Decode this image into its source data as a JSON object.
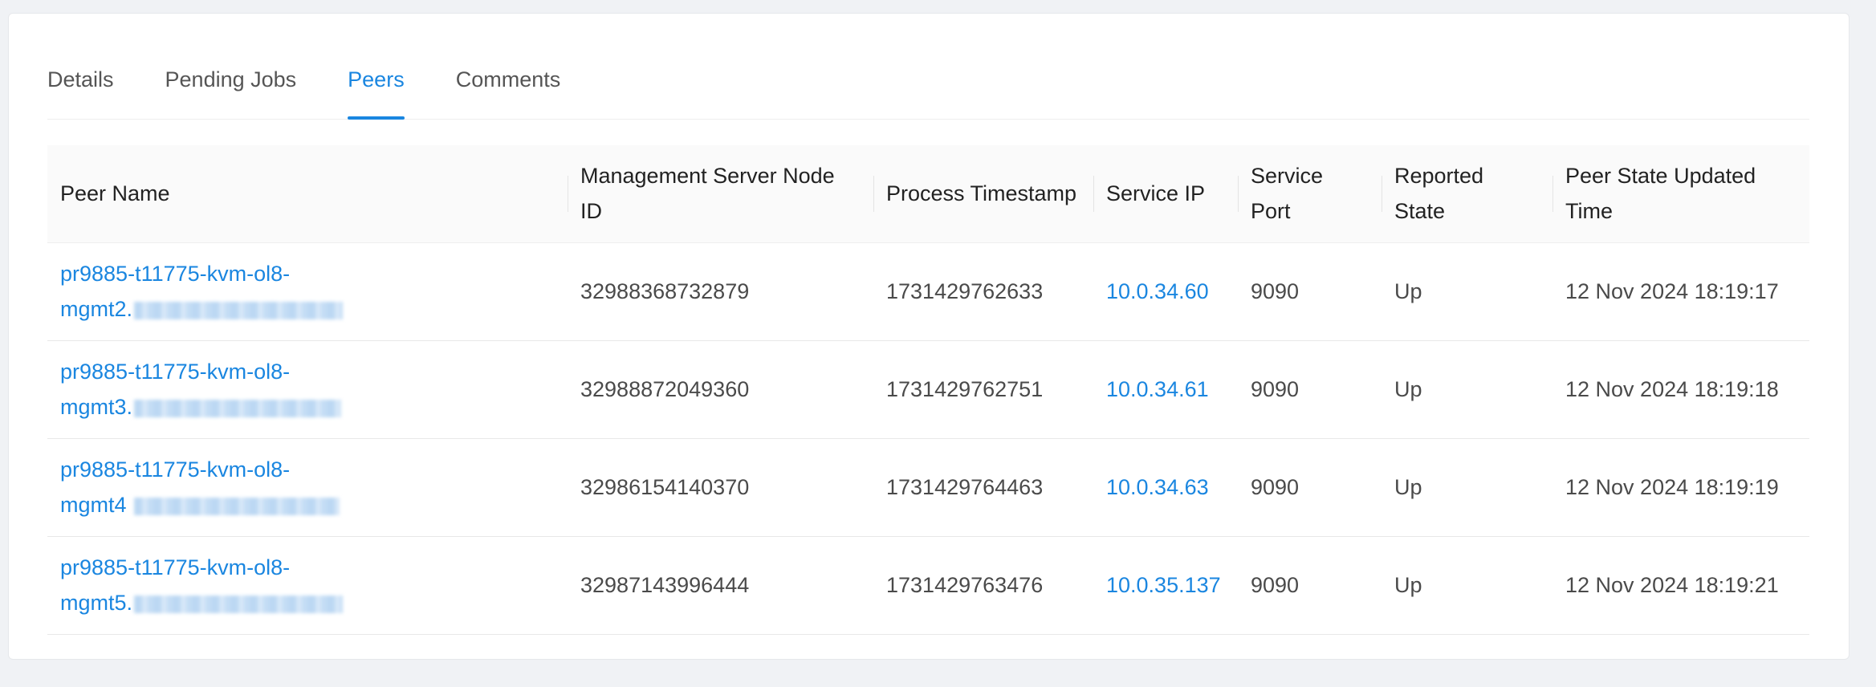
{
  "tabs": [
    {
      "label": "Details",
      "active": false
    },
    {
      "label": "Pending Jobs",
      "active": false
    },
    {
      "label": "Peers",
      "active": true
    },
    {
      "label": "Comments",
      "active": false
    }
  ],
  "table": {
    "columns": [
      "Peer Name",
      "Management Server Node ID",
      "Process Timestamp",
      "Service IP",
      "Service Port",
      "Reported State",
      "Peer State Updated Time"
    ],
    "rows": [
      {
        "peer_name_line1": "pr9885-t11775-kvm-ol8-",
        "peer_name_line2": "mgmt2.",
        "node_id": "32988368732879",
        "timestamp": "1731429762633",
        "service_ip": "10.0.34.60",
        "port": "9090",
        "state": "Up",
        "updated": "12 Nov 2024 18:19:17"
      },
      {
        "peer_name_line1": "pr9885-t11775-kvm-ol8-",
        "peer_name_line2": "mgmt3.",
        "node_id": "32988872049360",
        "timestamp": "1731429762751",
        "service_ip": "10.0.34.61",
        "port": "9090",
        "state": "Up",
        "updated": "12 Nov 2024 18:19:18"
      },
      {
        "peer_name_line1": "pr9885-t11775-kvm-ol8-",
        "peer_name_line2": "mgmt4",
        "node_id": "32986154140370",
        "timestamp": "1731429764463",
        "service_ip": "10.0.34.63",
        "port": "9090",
        "state": "Up",
        "updated": "12 Nov 2024 18:19:19"
      },
      {
        "peer_name_line1": "pr9885-t11775-kvm-ol8-",
        "peer_name_line2": "mgmt5.",
        "node_id": "32987143996444",
        "timestamp": "1731429763476",
        "service_ip": "10.0.35.137",
        "port": "9090",
        "state": "Up",
        "updated": "12 Nov 2024 18:19:21"
      }
    ]
  },
  "colors": {
    "accent": "#1a86e0",
    "background": "#f0f2f5",
    "header_bg": "#fafafa"
  }
}
